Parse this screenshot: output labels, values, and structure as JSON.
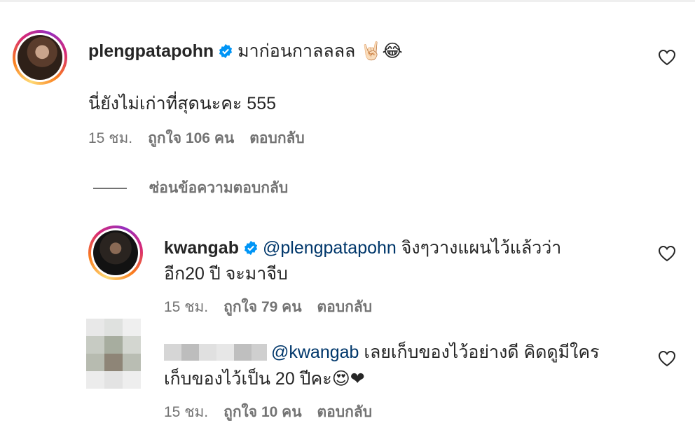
{
  "comments": [
    {
      "username": "plengpatapohn",
      "text_line1": "มาก่อนกาลลลล 🤘🏻😂",
      "text_line2": "นี่ยังไม่เก่าที่สุดนะคะ 555",
      "time": "15 ชม.",
      "likes": "ถูกใจ 106 คน",
      "reply_label": "ตอบกลับ"
    }
  ],
  "hide_replies_label": "ซ่อนข้อความตอบกลับ",
  "replies": [
    {
      "username": "kwangab",
      "mention": "@plengpatapohn",
      "text_line1": " จิงๆวางแผนไว้แล้วว่า",
      "text_line2": "อีก20 ปี จะมาจีบ",
      "time": "15 ชม.",
      "likes": "ถูกใจ 79 คน",
      "reply_label": "ตอบกลับ"
    },
    {
      "username": "",
      "mention": "@kwangab",
      "text_line1": " เลยเก็บของไว้อย่างดี คิดดูมีใคร",
      "text_line2": "เก็บของไว้เป็น 20 ปีคะ😍❤",
      "time": "15 ชม.",
      "likes": "ถูกใจ 10 คน",
      "reply_label": "ตอบกลับ"
    }
  ],
  "colors": {
    "text": "#262626",
    "secondary": "#737373",
    "mention": "#00376b",
    "verified": "#0095f6"
  },
  "icons": [
    "verified-badge-icon",
    "heart-icon"
  ]
}
